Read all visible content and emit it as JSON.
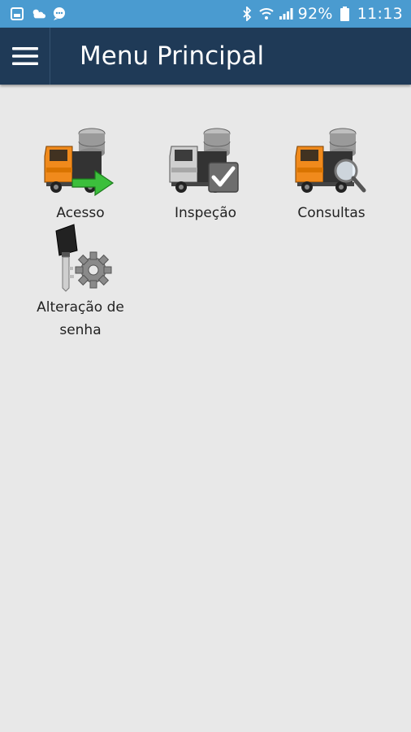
{
  "status_bar": {
    "battery_percent": "92%",
    "time": "11:13",
    "left_icons": [
      "gallery-icon",
      "weather-icon",
      "chat-icon"
    ],
    "right_icons": [
      "bluetooth-icon",
      "wifi-icon",
      "signal-icon",
      "battery-icon"
    ]
  },
  "app_bar": {
    "title": "Menu Principal",
    "menu_icon": "hamburger-menu-icon",
    "background": "#1f3a57"
  },
  "menu": {
    "items": [
      {
        "label": "Acesso",
        "icon": "truck-access-icon"
      },
      {
        "label": "Inspeção",
        "icon": "truck-inspection-icon"
      },
      {
        "label": "Consultas",
        "icon": "truck-query-icon"
      },
      {
        "label": "Alteração de senha",
        "icon": "key-gear-icon"
      }
    ]
  },
  "colors": {
    "status_bar": "#4a9bd0",
    "app_bar": "#1f3a57",
    "background": "#e8e8e8",
    "truck_orange": "#f08a1c"
  }
}
